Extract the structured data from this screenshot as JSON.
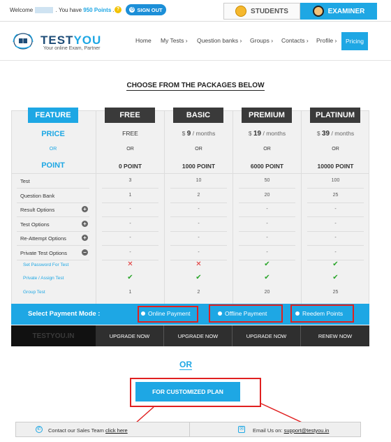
{
  "topbar": {
    "welcome_prefix": "Welcome",
    "welcome_mid": ". You have",
    "points": "950 Points",
    "welcome_suffix": ".",
    "help_icon": "question-icon",
    "signout_label": "SIGN OUT"
  },
  "role_tabs": {
    "students": "STUDENTS",
    "examiner": "EXAMINER"
  },
  "brand": {
    "logo_main": "TEST",
    "logo_accent": "YOU",
    "tagline": "Your online Exam, Partner"
  },
  "nav": {
    "home": "Home",
    "my_tests": "My Tests",
    "question_banks": "Question banks",
    "groups": "Groups",
    "contacts": "Contacts",
    "profile": "Profile",
    "pricing": "Pricing"
  },
  "page": {
    "heading": "CHOOSE FROM THE PACKAGES BELOW"
  },
  "feature_col": {
    "header": "FEATURE",
    "price": "PRICE",
    "or": "OR",
    "point": "POINT"
  },
  "plans": [
    {
      "name": "FREE",
      "price_prefix": "",
      "price_value": "FREE",
      "price_suffix": "",
      "or": "OR",
      "points": "0 POINT",
      "action": "UPGRADE NOW"
    },
    {
      "name": "BASIC",
      "price_prefix": "$",
      "price_value": "9",
      "price_suffix": "/ months",
      "or": "OR",
      "points": "1000 POINT",
      "action": "UPGRADE NOW"
    },
    {
      "name": "PREMIUM",
      "price_prefix": "$",
      "price_value": "19",
      "price_suffix": "/ months",
      "or": "OR",
      "points": "6000 POINT",
      "action": "UPGRADE NOW"
    },
    {
      "name": "PLATINUM",
      "price_prefix": "$",
      "price_value": "39",
      "price_suffix": "/ months",
      "or": "OR",
      "points": "10000 POINT",
      "action": "RENEW NOW"
    }
  ],
  "features": [
    {
      "label": "Test",
      "values": [
        "3",
        "10",
        "50",
        "100"
      ]
    },
    {
      "label": "Question Bank",
      "values": [
        "1",
        "2",
        "20",
        "25"
      ]
    },
    {
      "label": "Result Options",
      "values": [
        "-",
        "-",
        "-",
        "-"
      ]
    },
    {
      "label": "Test Options",
      "values": [
        "-",
        "-",
        "-",
        "-"
      ]
    },
    {
      "label": "Re-Attempt Options",
      "values": [
        "-",
        "-",
        "-",
        "-"
      ]
    },
    {
      "label": "Private Test Options",
      "values": [
        "-",
        "-",
        "-",
        "-"
      ]
    },
    {
      "label": "Set Password For Test",
      "values": [
        "✕",
        "✕",
        "✔",
        "✔"
      ]
    },
    {
      "label": "Private / Assign Test",
      "values": [
        "✔",
        "✔",
        "✔",
        "✔"
      ]
    },
    {
      "label": "Group Test",
      "values": [
        "1",
        "2",
        "20",
        "25"
      ]
    }
  ],
  "payment": {
    "label": "Select Payment Mode :",
    "options": [
      "Online Payment",
      "Offline Payment",
      "Reedem Points"
    ]
  },
  "buttons": {
    "brand_cell": "TESTYOU.IN"
  },
  "or_divider": "OR",
  "custom_plan": "FOR CUSTOMIZED PLAN",
  "footer": {
    "contact_text": "Contact our Sales Team",
    "contact_link": "click here",
    "email_text": "Email Us on:",
    "email_link": "support@testyou.in"
  },
  "colors": {
    "accent": "#1ea7e4",
    "dark_header": "#3a3a3a",
    "highlight": "#e02020",
    "tick": "#2aa52a",
    "cross": "#e03030"
  }
}
